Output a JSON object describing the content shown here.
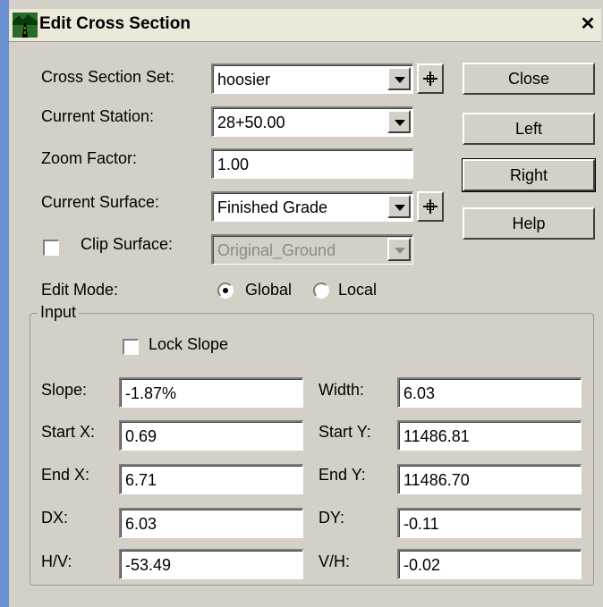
{
  "window": {
    "title": "Edit Cross Section",
    "close_symbol": "✕",
    "icon": "road-icon"
  },
  "form": {
    "cross_section_set": {
      "label": "Cross Section Set:",
      "value": "hoosier"
    },
    "current_station": {
      "label": "Current Station:",
      "value": "28+50.00"
    },
    "zoom_factor": {
      "label": "Zoom Factor:",
      "value": "1.00"
    },
    "current_surface": {
      "label": "Current Surface:",
      "value": "Finished Grade"
    },
    "clip_surface": {
      "label": "Clip Surface:",
      "value": "Original_Ground",
      "checked": false,
      "enabled": false
    },
    "edit_mode": {
      "label": "Edit Mode:",
      "options": [
        "Global",
        "Local"
      ],
      "selected": "Global"
    }
  },
  "buttons": {
    "close": "Close",
    "left": "Left",
    "right": "Right",
    "help": "Help"
  },
  "input_group": {
    "title": "Input",
    "lock_slope": {
      "label": "Lock Slope",
      "checked": false
    },
    "fields": {
      "slope": {
        "label": "Slope:",
        "value": "-1.87%"
      },
      "width": {
        "label": "Width:",
        "value": "6.03"
      },
      "start_x": {
        "label": "Start X:",
        "value": "0.69"
      },
      "start_y": {
        "label": "Start Y:",
        "value": "11486.81"
      },
      "end_x": {
        "label": "End X:",
        "value": "6.71"
      },
      "end_y": {
        "label": "End Y:",
        "value": "11486.70"
      },
      "dx": {
        "label": "DX:",
        "value": "6.03"
      },
      "dy": {
        "label": "DY:",
        "value": "-0.11"
      },
      "hv": {
        "label": "H/V:",
        "value": "-53.49"
      },
      "vh": {
        "label": "V/H:",
        "value": "-0.02"
      }
    }
  }
}
